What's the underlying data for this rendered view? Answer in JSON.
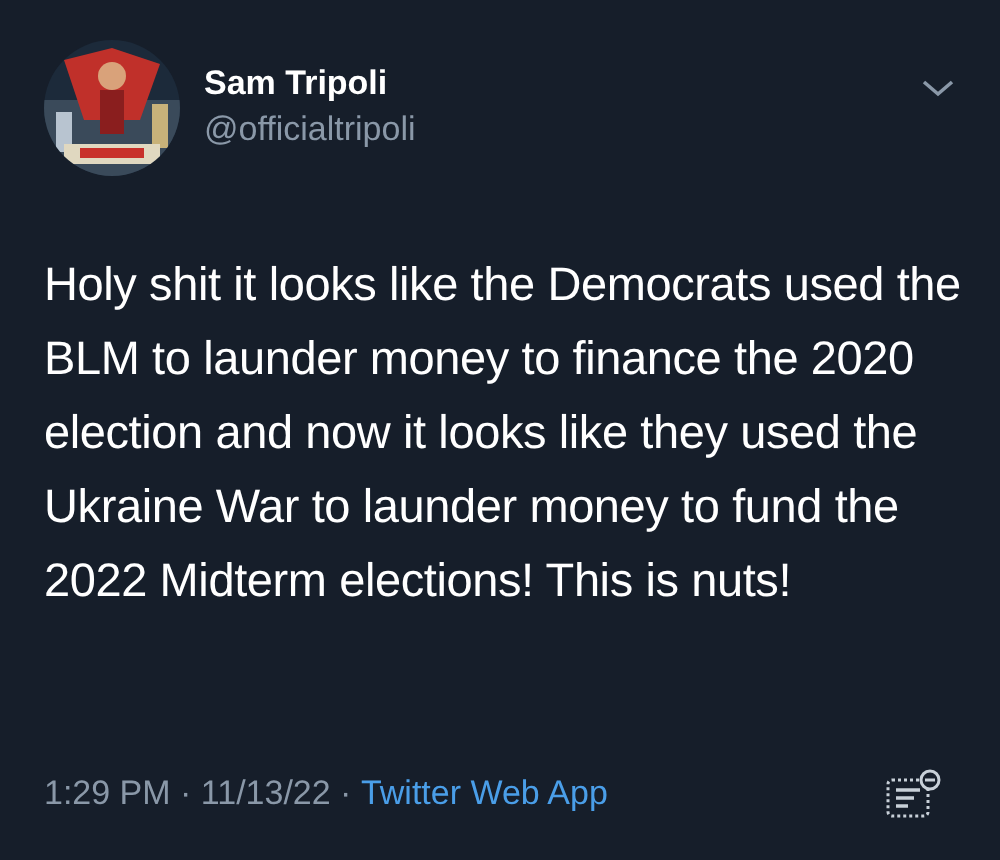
{
  "author": {
    "name": "Sam Tripoli",
    "handle": "@officialtripoli"
  },
  "tweet": {
    "text": "Holy shit it looks like the Democrats used the BLM to launder money to finance the 2020 election and now it looks like they used the Ukraine War to launder money to fund the 2022 Midterm elections! This is nuts!"
  },
  "footer": {
    "timestamp": "1:29 PM · 11/13/22 · ",
    "source": "Twitter Web App"
  }
}
